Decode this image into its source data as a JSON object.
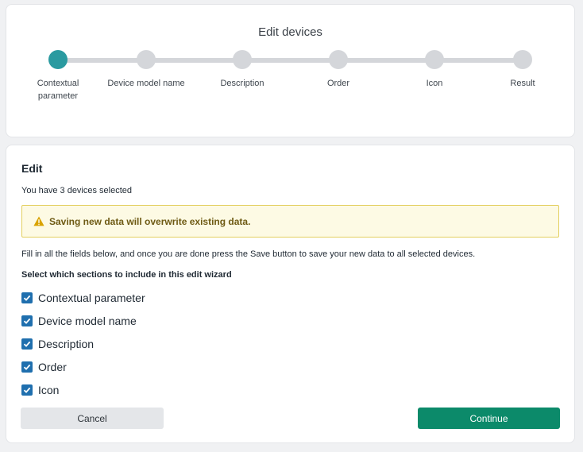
{
  "wizard": {
    "title": "Edit devices",
    "active_step": 0,
    "steps": [
      {
        "label": "Contextual parameter"
      },
      {
        "label": "Device model name"
      },
      {
        "label": "Description"
      },
      {
        "label": "Order"
      },
      {
        "label": "Icon"
      },
      {
        "label": "Result"
      }
    ]
  },
  "edit": {
    "heading": "Edit",
    "selected_text": "You have 3 devices selected",
    "warning": "Saving new data will overwrite existing data.",
    "instructions": "Fill in all the fields below, and once you are done press the Save button to save your new data to all selected devices.",
    "sections_heading": "Select which sections to include in this edit wizard",
    "sections": [
      {
        "label": "Contextual parameter",
        "checked": true
      },
      {
        "label": "Device model name",
        "checked": true
      },
      {
        "label": "Description",
        "checked": true
      },
      {
        "label": "Order",
        "checked": true
      },
      {
        "label": "Icon",
        "checked": true
      }
    ]
  },
  "buttons": {
    "cancel": "Cancel",
    "continue": "Continue"
  },
  "colors": {
    "active_step": "#2a9aa0",
    "inactive_step": "#d4d6da",
    "checkbox": "#1f6fae",
    "continue_button": "#0c8a6a",
    "warning_background": "#fdfae4",
    "warning_border": "#e3cf5f",
    "warning_icon": "#d9a300"
  },
  "icons": {
    "warning": "warning-triangle-icon",
    "checkbox": "checkmark-icon"
  }
}
